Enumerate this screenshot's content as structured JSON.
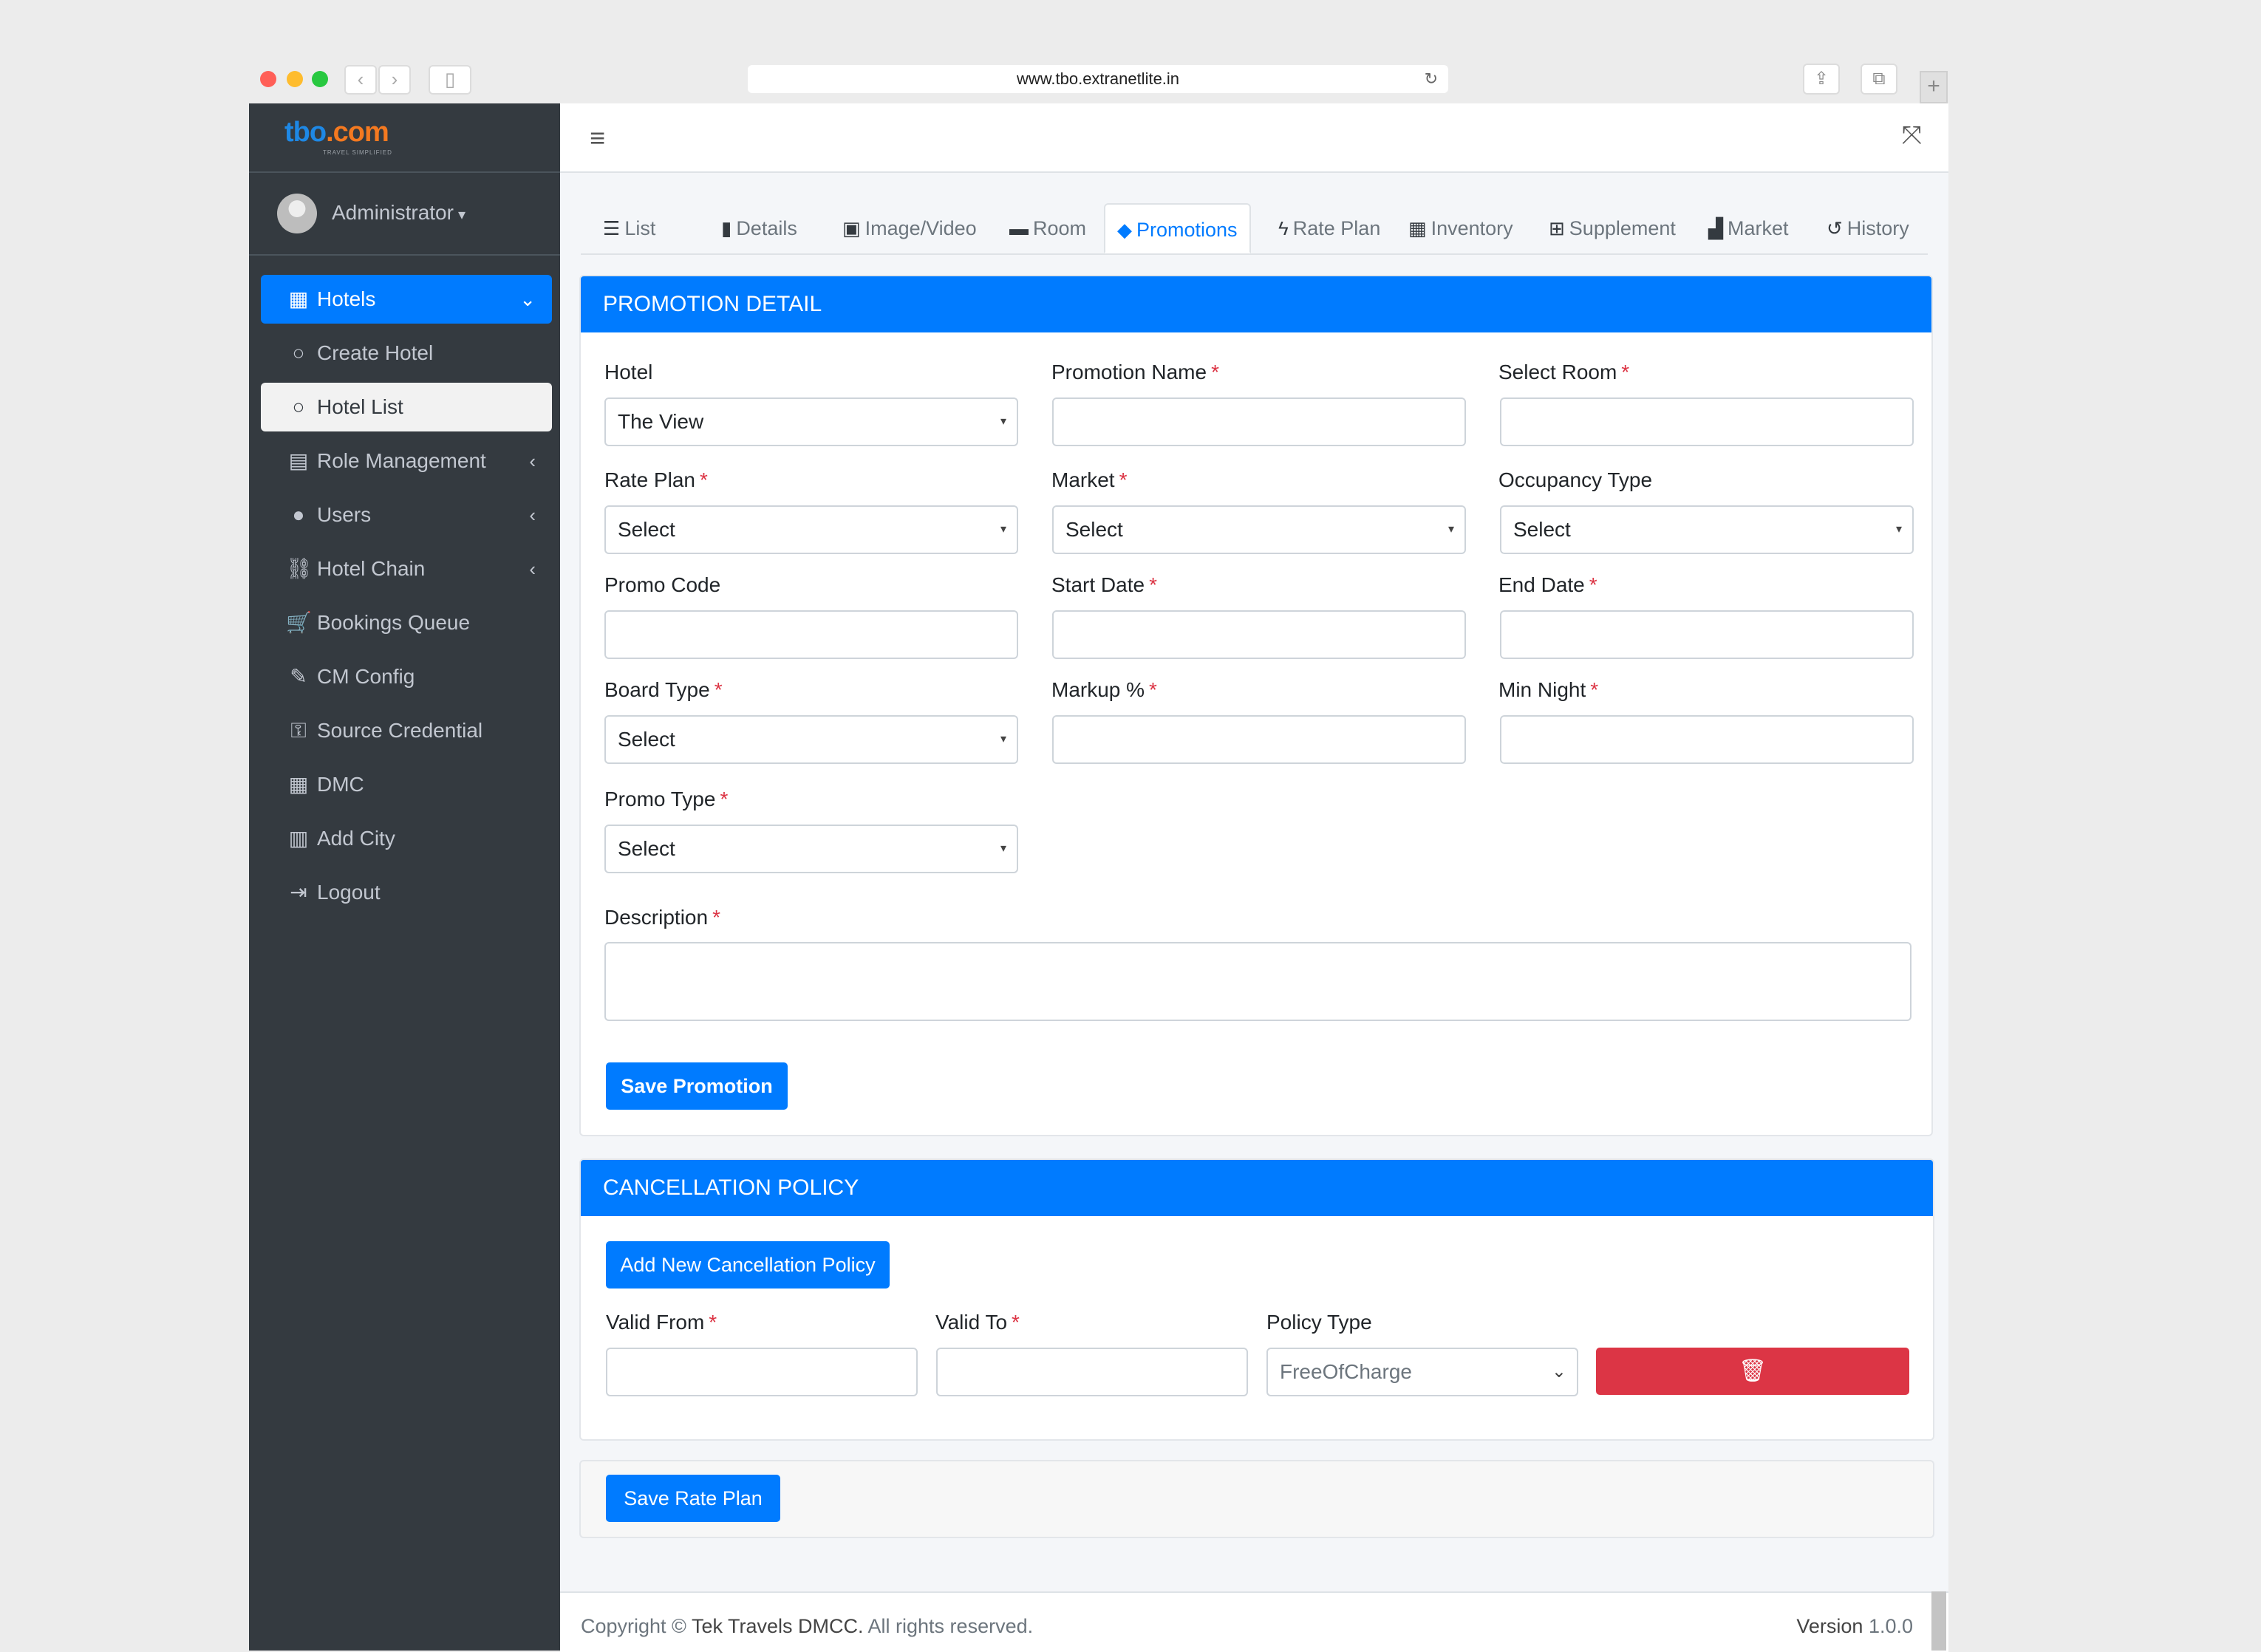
{
  "browser": {
    "url": "www.tbo.extranetlite.in",
    "reload_icon": "↻",
    "back_icon": "‹",
    "forward_icon": "›",
    "sidebar_icon": "▯",
    "share_icon": "⇪",
    "tabs_icon": "⧉",
    "newtab_icon": "+",
    "colors": {
      "close": "#ff5f57",
      "minimize": "#febc2e",
      "maximize": "#28c840"
    }
  },
  "brand": {
    "part1": "tbo",
    "part2": ".com",
    "tagline": "TRAVEL SIMPLIFIED"
  },
  "user": {
    "name": "Administrator",
    "caret": "▾"
  },
  "nav": {
    "hotels": {
      "label": "Hotels",
      "icon": "▦",
      "arrow": "⌄"
    },
    "create_hotel": {
      "label": "Create Hotel",
      "icon": "○"
    },
    "hotel_list": {
      "label": "Hotel List",
      "icon": "○"
    },
    "role_management": {
      "label": "Role Management",
      "icon": "▤",
      "arrow": "‹"
    },
    "users": {
      "label": "Users",
      "icon": "●",
      "arrow": "‹"
    },
    "hotel_chain": {
      "label": "Hotel Chain",
      "icon": "⛓",
      "arrow": "‹"
    },
    "bookings_queue": {
      "label": "Bookings Queue",
      "icon": "🛒"
    },
    "cm_config": {
      "label": "CM Config",
      "icon": "✎"
    },
    "source_credential": {
      "label": "Source Credential",
      "icon": "⚿"
    },
    "dmc": {
      "label": "DMC",
      "icon": "▦"
    },
    "add_city": {
      "label": "Add City",
      "icon": "▥"
    },
    "logout": {
      "label": "Logout",
      "icon": "⇥"
    }
  },
  "topbar": {
    "menu_icon": "≡",
    "fullscreen_icon": "⤧"
  },
  "tabs": {
    "list": {
      "label": "List",
      "icon": "☰"
    },
    "details": {
      "label": "Details",
      "icon": "▮"
    },
    "image_video": {
      "label": "Image/Video",
      "icon": "▣"
    },
    "room": {
      "label": "Room",
      "icon": "▬"
    },
    "promotions": {
      "label": "Promotions",
      "icon": "◆"
    },
    "rate_plan": {
      "label": "Rate Plan",
      "icon": "ϟ"
    },
    "inventory": {
      "label": "Inventory",
      "icon": "▦"
    },
    "supplement": {
      "label": "Supplement",
      "icon": "⊞"
    },
    "market": {
      "label": "Market",
      "icon": "▟"
    },
    "history": {
      "label": "History",
      "icon": "↺"
    }
  },
  "promotion": {
    "header": "PROMOTION DETAIL",
    "required_mark": "*",
    "select_caret": "▾",
    "hotel": {
      "label": "Hotel",
      "value": "The View"
    },
    "promotion_name": {
      "label": "Promotion Name",
      "value": ""
    },
    "select_room": {
      "label": "Select Room",
      "value": ""
    },
    "rate_plan": {
      "label": "Rate Plan",
      "value": "Select"
    },
    "market": {
      "label": "Market",
      "value": "Select"
    },
    "occupancy_type": {
      "label": "Occupancy Type",
      "value": "Select"
    },
    "promo_code": {
      "label": "Promo Code",
      "value": ""
    },
    "start_date": {
      "label": "Start Date",
      "value": ""
    },
    "end_date": {
      "label": "End Date",
      "value": ""
    },
    "board_type": {
      "label": "Board Type",
      "value": "Select"
    },
    "markup": {
      "label": "Markup %",
      "value": ""
    },
    "min_night": {
      "label": "Min Night",
      "value": ""
    },
    "promo_type": {
      "label": "Promo Type",
      "value": "Select"
    },
    "description": {
      "label": "Description",
      "value": ""
    },
    "save_button": "Save Promotion"
  },
  "cancellation": {
    "header": "CANCELLATION POLICY",
    "add_button": "Add New Cancellation Policy",
    "valid_from": {
      "label": "Valid From",
      "value": ""
    },
    "valid_to": {
      "label": "Valid To",
      "value": ""
    },
    "policy_type": {
      "label": "Policy Type",
      "value": "FreeOfCharge",
      "chevron": "⌄"
    },
    "delete_icon": "🗑"
  },
  "save_rate_plan": "Save Rate Plan",
  "footer": {
    "copyright_prefix": "Copyright © ",
    "company": "Tek Travels DMCC.",
    "rights": " All rights reserved.",
    "version_label": "Version",
    "version_value": "1.0.0"
  }
}
